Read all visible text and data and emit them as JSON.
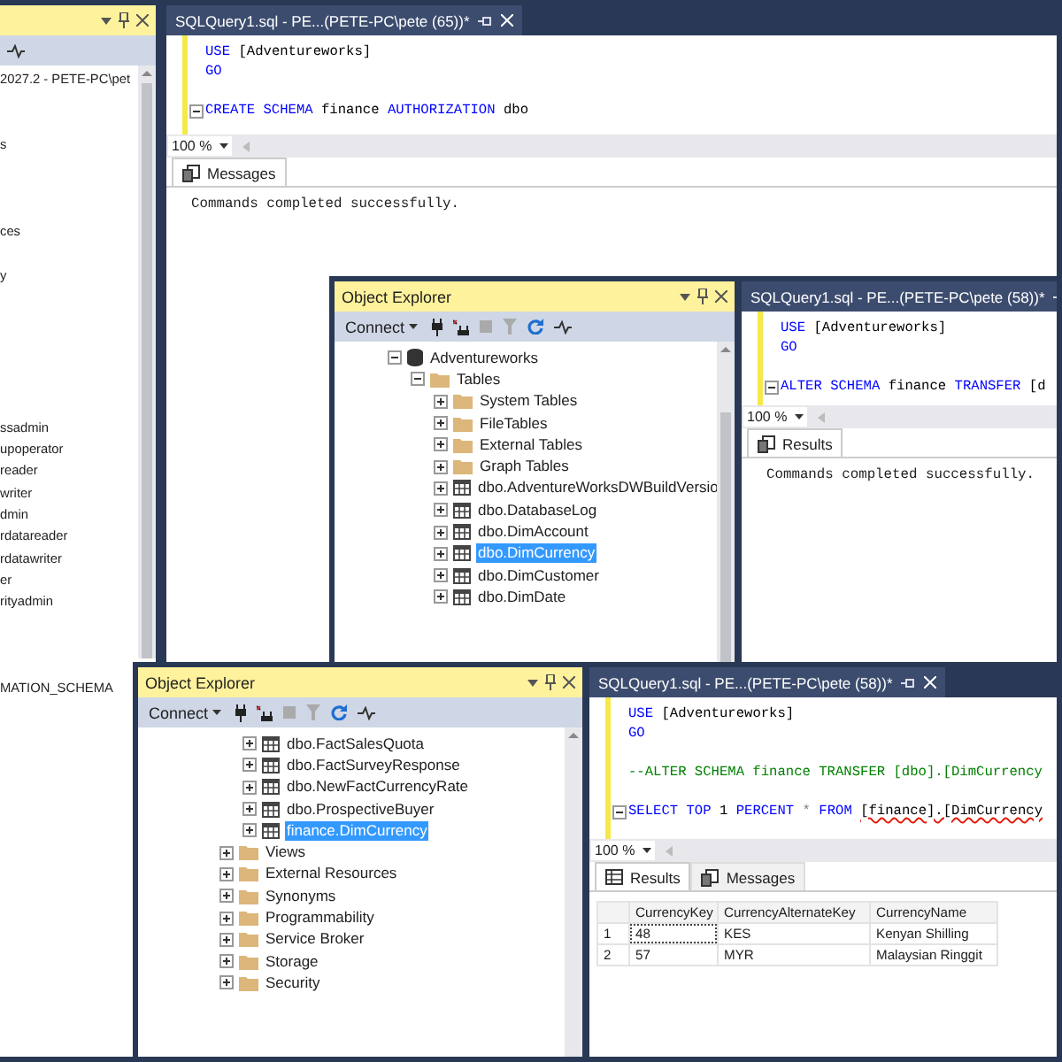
{
  "windows": [
    {
      "kind": "object_explorer",
      "tree_flat": [
        {
          "label": "2027.2 - PETE-PC\\pet"
        },
        {
          "label": "s"
        },
        {
          "label": "ces"
        },
        {
          "label": "y"
        },
        {
          "label": "ssadmin"
        },
        {
          "label": "upoperator"
        },
        {
          "label": "reader"
        },
        {
          "label": "writer"
        },
        {
          "label": "dmin"
        },
        {
          "label": "rdatareader"
        },
        {
          "label": "rdatawriter"
        },
        {
          "label": "er"
        },
        {
          "label": "rityadmin"
        },
        {
          "label": "MATION_SCHEMA"
        }
      ]
    },
    {
      "kind": "query",
      "tab": "SQLQuery1.sql - PE...(PETE-PC\\pete (65))*",
      "code": [
        {
          "tokens": [
            {
              "text": "USE",
              "color": "#0000ff"
            },
            {
              "text": " [Adventureworks]",
              "color": "#000000"
            }
          ]
        },
        {
          "tokens": [
            {
              "text": "GO",
              "color": "#0000ff"
            }
          ]
        },
        {
          "gap_before": true,
          "foldable": true,
          "tokens": [
            {
              "text": "CREATE SCHEMA",
              "color": "#0000ff"
            },
            {
              "text": " finance ",
              "color": "#000000"
            },
            {
              "text": "AUTHORIZATION",
              "color": "#0000ff"
            },
            {
              "text": " dbo",
              "color": "#000000"
            }
          ]
        }
      ],
      "zoom": "100 %",
      "result_tabs": [
        {
          "label": "Messages",
          "kind": "messages",
          "selected": true
        }
      ],
      "message": "Commands completed successfully."
    },
    {
      "kind": "object_explorer",
      "title": "Object Explorer",
      "connect_label": "Connect",
      "tree": [
        {
          "label": "Adventureworks",
          "kind": "database",
          "expanded": true,
          "selected": false,
          "children": [
            {
              "label": "Tables",
              "kind": "folder",
              "expanded": true,
              "selected": false,
              "children": [
                {
                  "label": "System Tables",
                  "kind": "folder",
                  "expanded": false,
                  "selected": false
                },
                {
                  "label": "FileTables",
                  "kind": "folder",
                  "expanded": false,
                  "selected": false
                },
                {
                  "label": "External Tables",
                  "kind": "folder",
                  "expanded": false,
                  "selected": false
                },
                {
                  "label": "Graph Tables",
                  "kind": "folder",
                  "expanded": false,
                  "selected": false
                },
                {
                  "label": "dbo.AdventureWorksDWBuildVersio",
                  "kind": "table",
                  "expanded": false,
                  "selected": false
                },
                {
                  "label": "dbo.DatabaseLog",
                  "kind": "table",
                  "expanded": false,
                  "selected": false
                },
                {
                  "label": "dbo.DimAccount",
                  "kind": "table",
                  "expanded": false,
                  "selected": false
                },
                {
                  "label": "dbo.DimCurrency",
                  "kind": "table",
                  "expanded": false,
                  "selected": true
                },
                {
                  "label": "dbo.DimCustomer",
                  "kind": "table",
                  "expanded": false,
                  "selected": false
                },
                {
                  "label": "dbo.DimDate",
                  "kind": "table",
                  "expanded": false,
                  "selected": false
                }
              ]
            }
          ]
        }
      ]
    },
    {
      "kind": "query",
      "tab": "SQLQuery1.sql - PE...(PETE-PC\\pete (58))*",
      "code": [
        {
          "tokens": [
            {
              "text": "USE",
              "color": "#0000ff"
            },
            {
              "text": " [Adventureworks]",
              "color": "#000000"
            }
          ]
        },
        {
          "tokens": [
            {
              "text": "GO",
              "color": "#0000ff"
            }
          ]
        },
        {
          "gap_before": true,
          "foldable": true,
          "tokens": [
            {
              "text": "ALTER SCHEMA",
              "color": "#0000ff"
            },
            {
              "text": " finance ",
              "color": "#000000"
            },
            {
              "text": "TRANSFER",
              "color": "#0000ff"
            },
            {
              "text": " [d",
              "color": "#000000"
            }
          ]
        }
      ],
      "zoom": "100 %",
      "result_tabs": [
        {
          "label": "Results",
          "kind": "messages",
          "selected": true
        }
      ],
      "message": "Commands completed successfully."
    },
    {
      "kind": "object_explorer",
      "title": "Object Explorer",
      "connect_label": "Connect",
      "tree": [
        {
          "children": [
            {
              "label": "dbo.FactSalesQuota",
              "kind": "table",
              "expanded": false,
              "selected": false
            },
            {
              "label": "dbo.FactSurveyResponse",
              "kind": "table",
              "expanded": false,
              "selected": false
            },
            {
              "label": "dbo.NewFactCurrencyRate",
              "kind": "table",
              "expanded": false,
              "selected": false
            },
            {
              "label": "dbo.ProspectiveBuyer",
              "kind": "table",
              "expanded": false,
              "selected": false
            },
            {
              "label": "finance.DimCurrency",
              "kind": "table",
              "expanded": false,
              "selected": true
            }
          ]
        },
        {
          "label": "Views",
          "kind": "folder",
          "expanded": false,
          "selected": false
        },
        {
          "label": "External Resources",
          "kind": "folder",
          "expanded": false,
          "selected": false
        },
        {
          "label": "Synonyms",
          "kind": "folder",
          "expanded": false,
          "selected": false
        },
        {
          "label": "Programmability",
          "kind": "folder",
          "expanded": false,
          "selected": false
        },
        {
          "label": "Service Broker",
          "kind": "folder",
          "expanded": false,
          "selected": false
        },
        {
          "label": "Storage",
          "kind": "folder",
          "expanded": false,
          "selected": false
        },
        {
          "label": "Security",
          "kind": "folder",
          "expanded": false,
          "selected": false
        }
      ]
    },
    {
      "kind": "query",
      "tab": "SQLQuery1.sql - PE...(PETE-PC\\pete (58))*",
      "code": [
        {
          "tokens": [
            {
              "text": "USE",
              "color": "#0000ff"
            },
            {
              "text": " [Adventureworks]",
              "color": "#000000"
            }
          ]
        },
        {
          "tokens": [
            {
              "text": "GO",
              "color": "#0000ff"
            }
          ]
        },
        {
          "gap_before": true,
          "tokens": [
            {
              "text": "--ALTER SCHEMA finance TRANSFER [dbo].[DimCurrency",
              "color": "#008000"
            }
          ]
        },
        {
          "gap_before": true,
          "foldable": true,
          "tokens": [
            {
              "text": "SELECT TOP",
              "color": "#0000ff"
            },
            {
              "text": " 1 ",
              "color": "#000000"
            },
            {
              "text": "PERCENT",
              "color": "#0000ff"
            },
            {
              "text": " * ",
              "color": "#808080"
            },
            {
              "text": "FROM ",
              "color": "#0000ff"
            },
            {
              "text": "[finance].[DimCurrency",
              "color": "#000000",
              "error": true
            }
          ]
        }
      ],
      "zoom": "100 %",
      "result_tabs": [
        {
          "label": "Results",
          "kind": "grid",
          "selected": true
        },
        {
          "label": "Messages",
          "kind": "messages",
          "selected": false
        }
      ],
      "grid": {
        "columns": [
          "CurrencyKey",
          "CurrencyAlternateKey",
          "CurrencyName"
        ],
        "rows": [
          {
            "number": "1",
            "focused": true,
            "cells": [
              "48",
              "KES",
              "Kenyan Shilling"
            ]
          },
          {
            "number": "2",
            "focused": false,
            "cells": [
              "57",
              "MYR",
              "Malaysian Ringgit"
            ]
          }
        ]
      }
    }
  ]
}
